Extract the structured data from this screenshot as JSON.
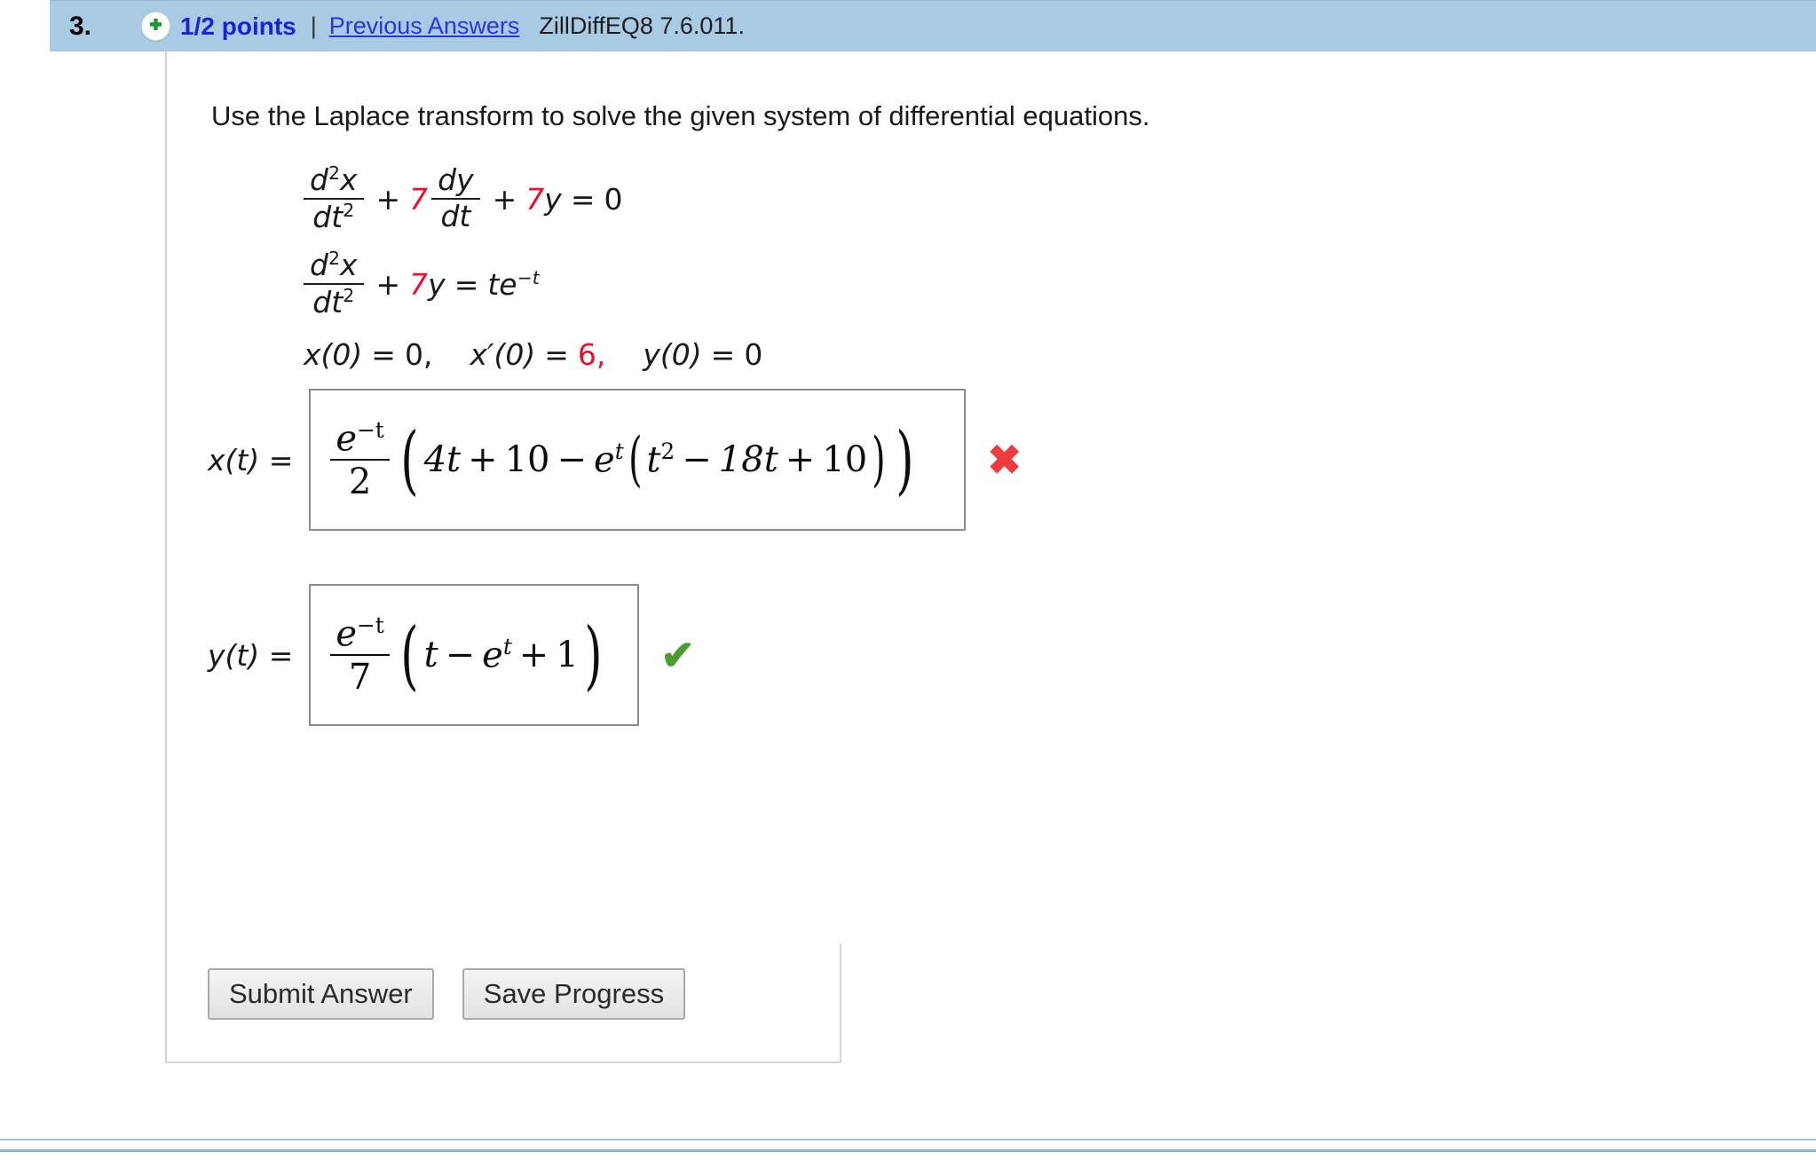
{
  "header": {
    "question_number": "3.",
    "plus_icon": "plus-circle-icon",
    "points": "1/2 points",
    "separator": "|",
    "previous_answers": "Previous Answers",
    "question_code": "ZillDiffEQ8 7.6.011.",
    "bar_color": "#a8cbe3",
    "link_color": "#2a36d9"
  },
  "problem": {
    "prompt": "Use the Laplace transform to solve the given system of differential equations.",
    "accent_color": "#e8112d",
    "equation1": {
      "frac1_num": "d2x",
      "frac1_den": "dt2",
      "op1": "+",
      "coef1": "7",
      "frac2_num": "dy",
      "frac2_den": "dt",
      "op2": "+",
      "coef2": "7",
      "var2": "y",
      "equals": "=",
      "rhs": "0"
    },
    "equation2": {
      "frac1_num": "d2x",
      "frac1_den": "dt2",
      "op1": "+",
      "coef1": "7",
      "var1": "y",
      "equals": "=",
      "rhs_t": "te",
      "rhs_exp": "−t"
    },
    "initial_conditions": {
      "ic1_lhs": "x(0)",
      "ic1_eq": "=",
      "ic1_val": "0,",
      "ic2_lhs": "x′(0)",
      "ic2_eq": "=",
      "ic2_val": "6,",
      "ic3_lhs": "y(0)",
      "ic3_eq": "=",
      "ic3_val": "0"
    }
  },
  "answers": [
    {
      "id": "x",
      "label": "x(t)  =",
      "frac_num": "e",
      "frac_num_exp": "−t",
      "frac_den": "2",
      "open_paren": "(",
      "body_a": "4t",
      "body_op1": "+",
      "body_b": "10",
      "body_op2": "−",
      "body_e": "e",
      "body_e_exp": "t",
      "inner_open": "(",
      "inner_a": "t",
      "inner_a_exp": "2",
      "inner_op1": "−",
      "inner_b": "18t",
      "inner_op2": "+",
      "inner_c": "10",
      "inner_close": ")",
      "close_paren": ")",
      "status": "incorrect",
      "status_mark": "✖",
      "status_color": "#ee3b3b"
    },
    {
      "id": "y",
      "label": "y(t)  =",
      "frac_num": "e",
      "frac_num_exp": "−t",
      "frac_den": "7",
      "open_paren": "(",
      "body_a": "t",
      "body_op1": "−",
      "body_e": "e",
      "body_e_exp": "t",
      "body_op2": "+",
      "body_b": "1",
      "close_paren": ")",
      "status": "correct",
      "status_mark": "✔",
      "status_color": "#4a9e2f"
    }
  ],
  "buttons": {
    "submit": "Submit Answer",
    "save": "Save Progress"
  }
}
